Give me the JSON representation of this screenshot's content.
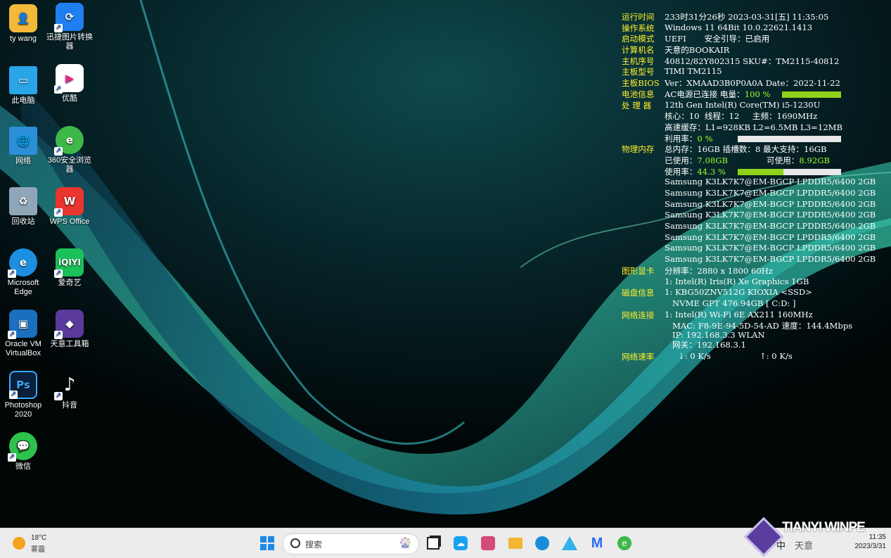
{
  "desktop_icons": [
    {
      "label": "ty wang",
      "icon": "folder-user-icon"
    },
    {
      "label": "迅捷图片转换器",
      "icon": "image-converter-icon"
    },
    {
      "label": "此电脑",
      "icon": "this-pc-icon"
    },
    {
      "label": "优酷",
      "icon": "youku-icon"
    },
    {
      "label": "网络",
      "icon": "network-icon"
    },
    {
      "label": "360安全浏览器",
      "icon": "360-browser-icon"
    },
    {
      "label": "回收站",
      "icon": "recycle-bin-icon"
    },
    {
      "label": "WPS Office",
      "icon": "wps-icon"
    },
    {
      "label": "Microsoft Edge",
      "icon": "edge-icon"
    },
    {
      "label": "爱奇艺",
      "icon": "iqiyi-icon"
    },
    {
      "label": "Oracle VM VirtualBox",
      "icon": "virtualbox-icon"
    },
    {
      "label": "天意工具箱",
      "icon": "toolbox-icon"
    },
    {
      "label": "Photoshop 2020",
      "icon": "photoshop-icon"
    },
    {
      "label": "抖音",
      "icon": "douyin-icon"
    },
    {
      "label": "微信",
      "icon": "wechat-icon"
    }
  ],
  "sysinfo": {
    "runtime": {
      "label": "运行时间",
      "value": "233时31分26秒 2023-03-31[五] 11:35:05"
    },
    "os": {
      "label": "操作系统",
      "value": "Windows 11 64Bit 10.0.22621.1413"
    },
    "boot": {
      "label": "启动模式",
      "value": "UEFI       安全引导：已启用"
    },
    "hostname": {
      "label": "计算机名",
      "value": "天意的BOOKAIR"
    },
    "serial": {
      "label": "主机序号",
      "value": "40812/82Y802315  SKU#：TM2115-40812"
    },
    "board": {
      "label": "主板型号",
      "value": "TIMI TM2115"
    },
    "bios": {
      "label": "主板BIOS",
      "value": "Ver：XMAAD3B0P0A0A  Date：2022-11-22"
    },
    "battery": {
      "label": "电池信息",
      "value": "AC电源已连接  电量：",
      "percent_text": "100 %",
      "percent": 1.0
    },
    "cpu": {
      "label": "处 理 器",
      "model": "12th Gen Intel(R) Core(TM) i5-1230U",
      "cores": "核心：10  线程：12     主频：1690MHz",
      "cache": "高速缓存：L1=928KB L2=6.5MB L3=12MB",
      "usage_label": "利用率：",
      "usage_text": "0 %",
      "usage": 0.0
    },
    "memory": {
      "label": "物理内存",
      "total": "总内存：16GB 插槽数：8 最大支持：16GB",
      "used_label": "已使用：",
      "used": "7.08GB",
      "avail_label": "可使用：",
      "avail": "8.92GB",
      "usage_label": "使用率：",
      "usage_text": "44.3 %",
      "usage": 0.443,
      "modules": [
        "Samsung K3LK7K7@EM-BGCP LPDDR5/6400 2GB",
        "Samsung K3LK7K7@EM-BGCP LPDDR5/6400 2GB",
        "Samsung K3LK7K7@EM-BGCP LPDDR5/6400 2GB",
        "Samsung K3LK7K7@EM-BGCP LPDDR5/6400 2GB",
        "Samsung K3LK7K7@EM-BGCP LPDDR5/6400 2GB",
        "Samsung K3LK7K7@EM-BGCP LPDDR5/6400 2GB",
        "Samsung K3LK7K7@EM-BGCP LPDDR5/6400 2GB",
        "Samsung K3LK7K7@EM-BGCP LPDDR5/6400 2GB"
      ]
    },
    "gpu": {
      "label": "图形显卡",
      "resolution": "分辨率：2880 x 1800 60Hz",
      "card": "1: Intel(R) Iris(R) Xe Graphics 1GB"
    },
    "disk": {
      "label": "磁盘信息",
      "line1": "1: KBG50ZNV512G KIOXIA <SSD>",
      "line2": "   NVME GPT 476.94GB [ C:D: ]"
    },
    "network": {
      "label": "网络连接",
      "adapter": "1: Intel(R) Wi-Fi 6E AX211 160MHz",
      "mac": "   MAC: F8-9E-94-5D-54-AD 速度：144.4Mbps",
      "ip": "   IP: 192.168.3.3 WLAN",
      "gateway": "   网关：192.168.3.1"
    },
    "speed": {
      "label": "网络速率",
      "down": "↓: 0 K/s",
      "up": "↑: 0 K/s"
    }
  },
  "taskbar": {
    "weather_temp": "18°C",
    "weather_desc": "雾霾",
    "search_placeholder": "搜索",
    "watermark": "TIANYI WINPE",
    "tray_lang": "中",
    "tray_ime": "天意",
    "clock_time": "11:35",
    "clock_date": "2023/3/31"
  },
  "colors": {
    "label": "#ffef2a",
    "value": "#ffffff",
    "highlight": "#9eff2a",
    "bar_fill": "#8fd21a",
    "taskbar": "#ececec"
  }
}
